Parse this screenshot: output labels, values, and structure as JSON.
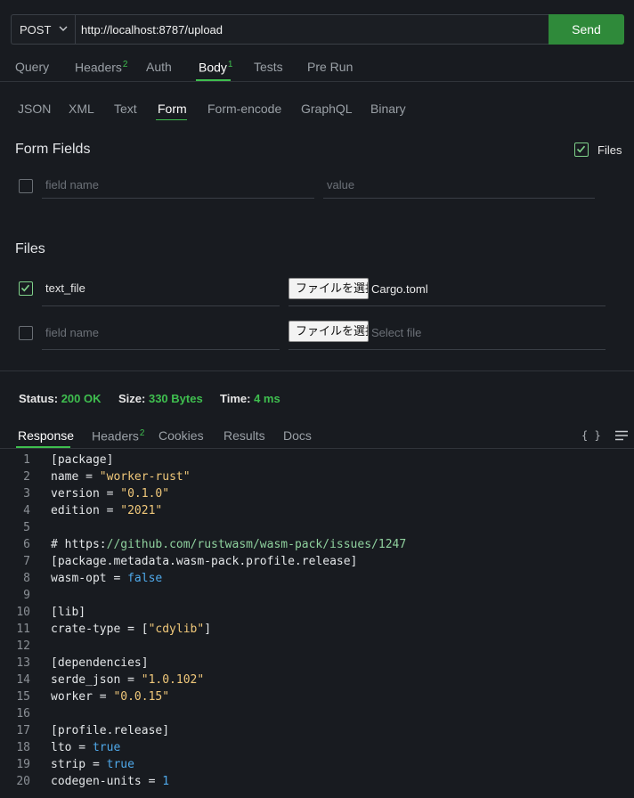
{
  "request": {
    "method": "POST",
    "url": "http://localhost:8787/upload",
    "send_label": "Send"
  },
  "tabs": [
    {
      "label": "Query",
      "badge": ""
    },
    {
      "label": "Headers",
      "badge": "2"
    },
    {
      "label": "Auth",
      "badge": ""
    },
    {
      "label": "Body",
      "badge": "1",
      "active": true
    },
    {
      "label": "Tests",
      "badge": ""
    },
    {
      "label": "Pre Run",
      "badge": ""
    }
  ],
  "body_types": [
    "JSON",
    "XML",
    "Text",
    "Form",
    "Form-encode",
    "GraphQL",
    "Binary"
  ],
  "active_body_type": "Form",
  "form": {
    "title": "Form Fields",
    "files_toggle_label": "Files",
    "files_toggle_checked": true,
    "field_placeholder": "field name",
    "value_placeholder": "value"
  },
  "files": {
    "title": "Files",
    "rows": [
      {
        "checked": true,
        "name": "text_file",
        "button": "ファイルを選択",
        "file": "Cargo.toml"
      },
      {
        "checked": false,
        "name": "",
        "name_placeholder": "field name",
        "button": "ファイルを選択",
        "file": "",
        "file_placeholder": "Select file"
      }
    ]
  },
  "status": {
    "status_label": "Status:",
    "status_value": "200 OK",
    "size_label": "Size:",
    "size_value": "330 Bytes",
    "time_label": "Time:",
    "time_value": "4 ms"
  },
  "response_tabs": [
    {
      "label": "Response",
      "badge": "",
      "active": true
    },
    {
      "label": "Headers",
      "badge": "2"
    },
    {
      "label": "Cookies",
      "badge": ""
    },
    {
      "label": "Results",
      "badge": ""
    },
    {
      "label": "Docs",
      "badge": ""
    }
  ],
  "icons": {
    "format": "{ }",
    "menu": "menu-icon"
  },
  "colors": {
    "accent": "#3fbf4f",
    "send": "#2f8a3a",
    "string": "#f0c87a",
    "keyword": "#4fa9ea"
  },
  "code_lines": [
    "[package]",
    "name = \"worker-rust\"",
    "version = \"0.1.0\"",
    "edition = \"2021\"",
    "",
    "# https://github.com/rustwasm/wasm-pack/issues/1247",
    "[package.metadata.wasm-pack.profile.release]",
    "wasm-opt = false",
    "",
    "[lib]",
    "crate-type = [\"cdylib\"]",
    "",
    "[dependencies]",
    "serde_json = \"1.0.102\"",
    "worker = \"0.0.15\"",
    "",
    "[profile.release]",
    "lto = true",
    "strip = true",
    "codegen-units = 1"
  ]
}
